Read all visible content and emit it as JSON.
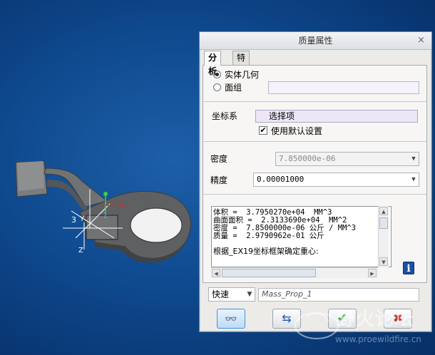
{
  "dialog": {
    "title": "质量属性",
    "close_glyph": "×",
    "tabs": [
      {
        "label": "分析",
        "active": true
      },
      {
        "label": "特征",
        "active": false
      }
    ],
    "geometry": {
      "solid_label": "实体几何",
      "solid_selected": true,
      "quilt_label": "面组",
      "quilt_selected": false,
      "quilt_value": ""
    },
    "csys": {
      "label": "坐标系",
      "selector_text": "选择项",
      "use_default_label": "使用默认设置",
      "use_default_checked": true,
      "check_glyph": "✔"
    },
    "density": {
      "label": "密度",
      "value": "7.850000e-06"
    },
    "accuracy": {
      "label": "精度",
      "value": "0.00001000"
    },
    "results": {
      "lines": [
        "体积 =  3.7950270e+04  MM^3",
        "曲面面积 =  2.3133690e+04  MM^2",
        "密度 =  7.8500000e-06 公斤 / MM^3",
        "质量 =  2.9790962e-01 公斤",
        "",
        "根据_EX19坐标框架确定重心:"
      ]
    },
    "info_glyph": "i",
    "mode": {
      "value": "快速",
      "name_value": "Mass_Prop_1"
    },
    "buttons": {
      "preview_glyph": "👓",
      "repeat_glyph": "⇆",
      "ok_glyph": "✔",
      "cancel_glyph": "✖"
    }
  },
  "model": {
    "csys_labels": [
      "3",
      "Y",
      "1",
      "Z"
    ],
    "colors": {
      "part": "#5e6062",
      "part_dark": "#3b3d3f",
      "axis_green": "#3cd23c",
      "axis_red": "#d03030"
    }
  },
  "watermark": {
    "text": "野火论坛",
    "url": "www.proewildfire.cn"
  },
  "icons": [
    "close-icon",
    "dropdown-arrow-icon",
    "info-icon",
    "glasses-icon",
    "repeat-icon",
    "ok-check-icon",
    "cancel-x-icon"
  ]
}
